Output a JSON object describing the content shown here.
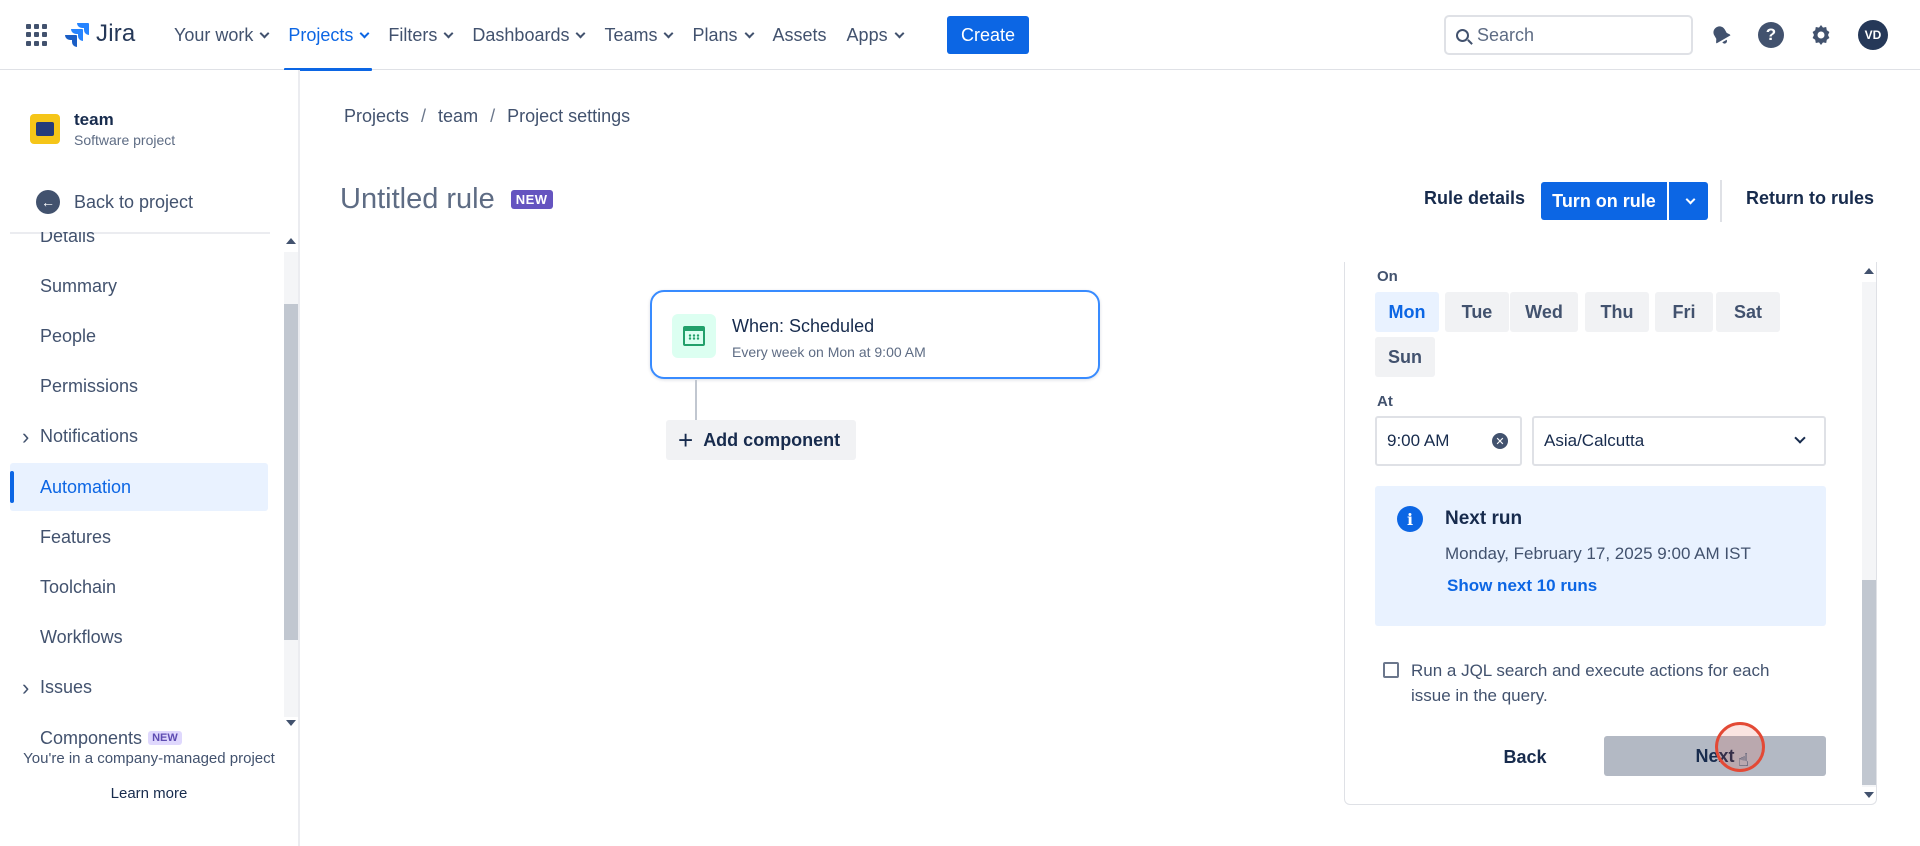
{
  "topnav": {
    "logo": "Jira",
    "items": [
      {
        "label": "Your work",
        "dropdown": true
      },
      {
        "label": "Projects",
        "dropdown": true,
        "active": true
      },
      {
        "label": "Filters",
        "dropdown": true
      },
      {
        "label": "Dashboards",
        "dropdown": true
      },
      {
        "label": "Teams",
        "dropdown": true
      },
      {
        "label": "Plans",
        "dropdown": true
      },
      {
        "label": "Assets",
        "dropdown": false
      },
      {
        "label": "Apps",
        "dropdown": true
      }
    ],
    "create_label": "Create",
    "search_placeholder": "Search",
    "avatar_initials": "VD"
  },
  "sidebar": {
    "project_name": "team",
    "project_type": "Software project",
    "back_label": "Back to project",
    "items": [
      {
        "label": "Details"
      },
      {
        "label": "Summary"
      },
      {
        "label": "People"
      },
      {
        "label": "Permissions"
      },
      {
        "label": "Notifications",
        "expandable": true
      },
      {
        "label": "Automation",
        "active": true
      },
      {
        "label": "Features"
      },
      {
        "label": "Toolchain"
      },
      {
        "label": "Workflows"
      },
      {
        "label": "Issues",
        "expandable": true
      },
      {
        "label": "Components",
        "badge": "NEW"
      }
    ],
    "footer_text": "You're in a company-managed project",
    "learn_more": "Learn more"
  },
  "breadcrumb": [
    "Projects",
    "team",
    "Project settings"
  ],
  "rule": {
    "title": "Untitled rule",
    "badge": "NEW",
    "details_label": "Rule details",
    "turn_on_label": "Turn on rule",
    "return_label": "Return to rules"
  },
  "trigger": {
    "title": "When: Scheduled",
    "subtitle": "Every week on Mon at 9:00 AM",
    "add_component": "Add component"
  },
  "schedule": {
    "on_label": "On",
    "days": [
      "Mon",
      "Tue",
      "Wed",
      "Thu",
      "Fri",
      "Sat",
      "Sun"
    ],
    "selected_day": "Mon",
    "at_label": "At",
    "time_value": "9:00 AM",
    "timezone": "Asia/Calcutta",
    "next_run_title": "Next run",
    "next_run_date": "Monday, February 17, 2025 9:00 AM IST",
    "show_next_runs": "Show next 10 runs",
    "jql_label": "Run a JQL search and execute actions for each issue in the query.",
    "jql_checked": false,
    "back_label": "Back",
    "next_label": "Next"
  },
  "colors": {
    "accent": "#0c66e4",
    "info_bg": "#e9f2ff",
    "new_badge": "#6554c0",
    "disabled_button": "#b3b9c4"
  }
}
